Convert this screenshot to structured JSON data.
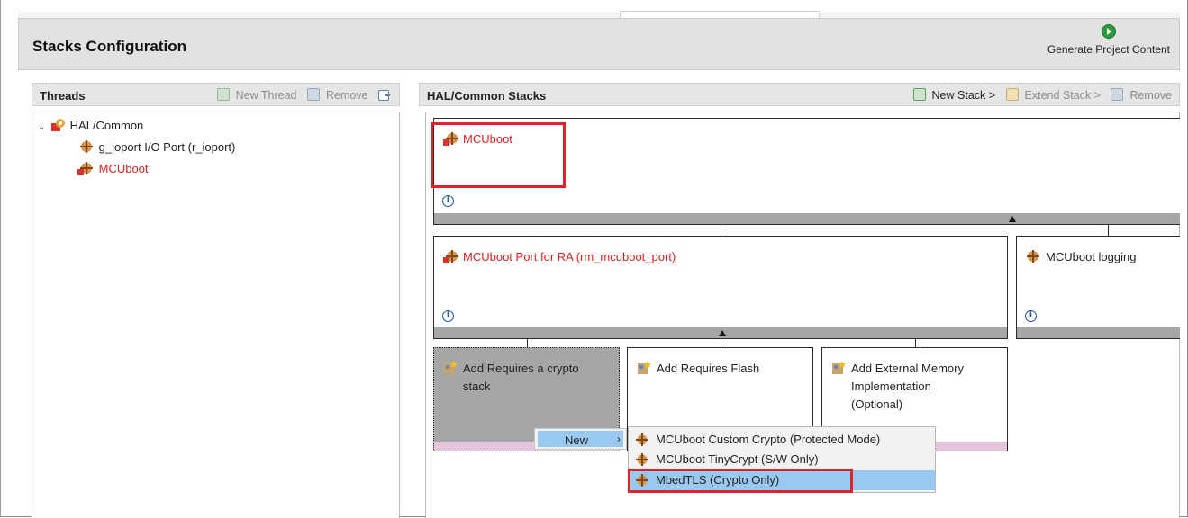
{
  "header": {
    "title": "Stacks Configuration",
    "generate_label": "Generate Project Content"
  },
  "threads_panel": {
    "title": "Threads",
    "new_thread_label": "New Thread",
    "remove_label": "Remove",
    "tree": [
      {
        "label": "HAL/Common"
      },
      {
        "label": "g_ioport I/O Port (r_ioport)"
      },
      {
        "label": "MCUboot"
      }
    ]
  },
  "stacks_panel": {
    "title": "HAL/Common Stacks",
    "new_stack_label": "New Stack >",
    "extend_stack_label": "Extend Stack >",
    "remove_label": "Remove",
    "boxes": {
      "mcuboot": "MCUboot",
      "port": "MCUboot Port for RA (rm_mcuboot_port)",
      "logging": "MCUboot logging",
      "crypto": [
        "Add Requires a crypto",
        "stack"
      ],
      "flash": "Add Requires Flash",
      "extmem": [
        "Add External Memory",
        "Implementation",
        "(Optional)"
      ]
    }
  },
  "context_menu": {
    "new_label": "New",
    "submenu": [
      "MCUboot Custom Crypto (Protected Mode)",
      "MCUboot TinyCrypt (S/W Only)",
      "MbedTLS (Crypto Only)"
    ]
  },
  "colors": {
    "highlight_red": "#e5202a",
    "module_red": "#e02020",
    "menu_selection": "#99c9ef"
  }
}
